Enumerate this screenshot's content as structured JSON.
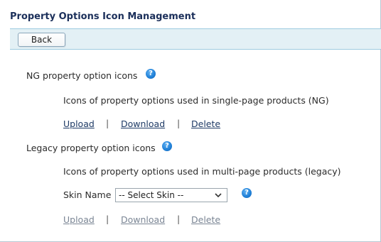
{
  "page": {
    "title": "Property Options Icon Management"
  },
  "toolbar": {
    "back_label": "Back"
  },
  "ng_section": {
    "title": "NG property option icons",
    "help_icon": "help-question-icon",
    "description": "Icons of property options used in single-page products (NG)",
    "links": {
      "upload": "Upload",
      "download": "Download",
      "delete": "Delete"
    },
    "separator": "|"
  },
  "legacy_section": {
    "title": "Legacy property option icons",
    "help_icon": "help-question-icon",
    "description": "Icons of property options used in multi-page products (legacy)",
    "skin_label": "Skin Name",
    "skin_select_value": "-- Select Skin --",
    "links": {
      "upload": "Upload",
      "download": "Download",
      "delete": "Delete"
    },
    "separator": "|"
  },
  "colors": {
    "title": "#1b2f5a",
    "toolbar_bg": "#e3f0f5",
    "link": "#1f3b66",
    "link_disabled": "#7a8594",
    "help_icon": "#1f7fd6"
  }
}
